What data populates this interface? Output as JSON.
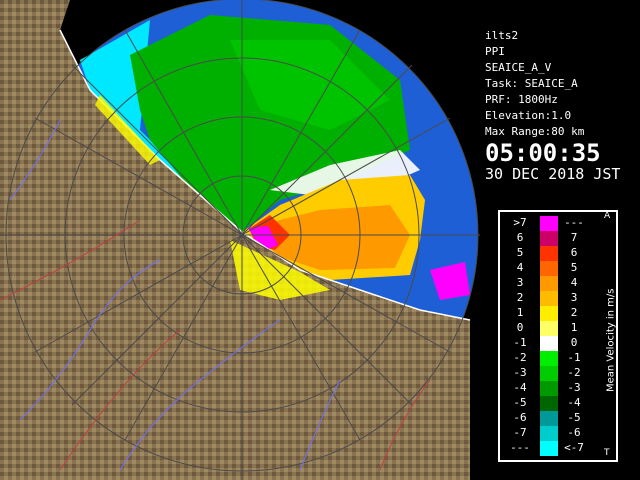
{
  "info": {
    "lines": [
      "ilts2",
      "PPI",
      "SEAICE_A_V",
      "Task: SEAICE_A",
      "PRF: 1800Hz",
      "Elevation:1.0",
      "Max Range:80 km"
    ],
    "time": "05:00:35",
    "date": "30 DEC 2018 JST"
  },
  "legend": {
    "title": "Mean Velocity in m/s",
    "top_mark": "A",
    "bottom_mark": "T",
    "rows": [
      {
        "left": ">7",
        "right": "---",
        "color": "#ff00ff"
      },
      {
        "left": "6",
        "right": "7",
        "color": "#cc0066"
      },
      {
        "left": "5",
        "right": "6",
        "color": "#ff3300"
      },
      {
        "left": "4",
        "right": "5",
        "color": "#ff6600"
      },
      {
        "left": "3",
        "right": "4",
        "color": "#ff9900"
      },
      {
        "left": "2",
        "right": "3",
        "color": "#ffbb00"
      },
      {
        "left": "1",
        "right": "2",
        "color": "#ffee00"
      },
      {
        "left": "0",
        "right": "1",
        "color": "#ffff66"
      },
      {
        "left": "-1",
        "right": "0",
        "color": "#ffffff"
      },
      {
        "left": "-2",
        "right": "-1",
        "color": "#00ee00"
      },
      {
        "left": "-3",
        "right": "-2",
        "color": "#00cc00"
      },
      {
        "left": "-4",
        "right": "-3",
        "color": "#009900"
      },
      {
        "left": "-5",
        "right": "-4",
        "color": "#006600"
      },
      {
        "left": "-6",
        "right": "-5",
        "color": "#009999"
      },
      {
        "left": "-7",
        "right": "-6",
        "color": "#00cccc"
      },
      {
        "left": "---",
        "right": "<-7",
        "color": "#00ffff"
      }
    ]
  },
  "colors": {
    "ocean_far": "#1f5fd6",
    "ocean_near": "#00e8ff",
    "land": "#8a7350",
    "rivers": "#6f6fff",
    "borders": "#c04040"
  }
}
